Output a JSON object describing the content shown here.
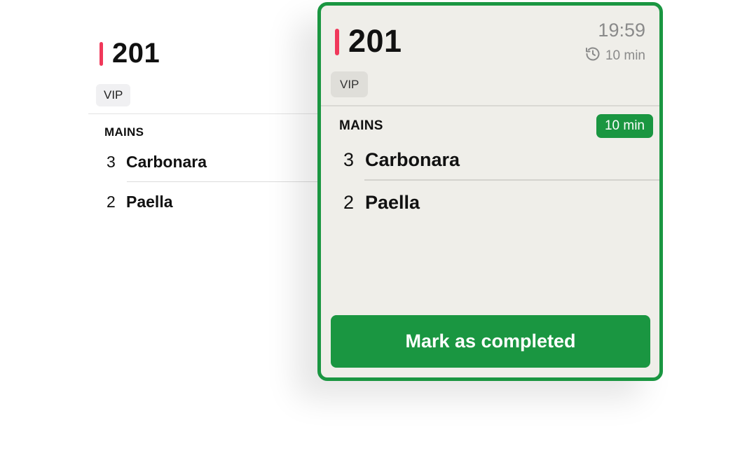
{
  "background_ticket": {
    "number": "201",
    "tag": "VIP",
    "section": "MAINS",
    "items": [
      {
        "qty": "3",
        "name": "Carbonara"
      },
      {
        "qty": "2",
        "name": "Paella"
      }
    ]
  },
  "active_ticket": {
    "number": "201",
    "time": "19:59",
    "elapsed": "10 min",
    "tag": "VIP",
    "section": "MAINS",
    "section_timer": "10 min",
    "items": [
      {
        "qty": "3",
        "name": "Carbonara"
      },
      {
        "qty": "2",
        "name": "Paella"
      }
    ],
    "button_label": "Mark as completed"
  },
  "icons": {
    "elapsed": "history-clock-icon"
  },
  "colors": {
    "accent": "#1a9641",
    "priority": "#f0385a",
    "ticket_background": "#efeee9"
  }
}
